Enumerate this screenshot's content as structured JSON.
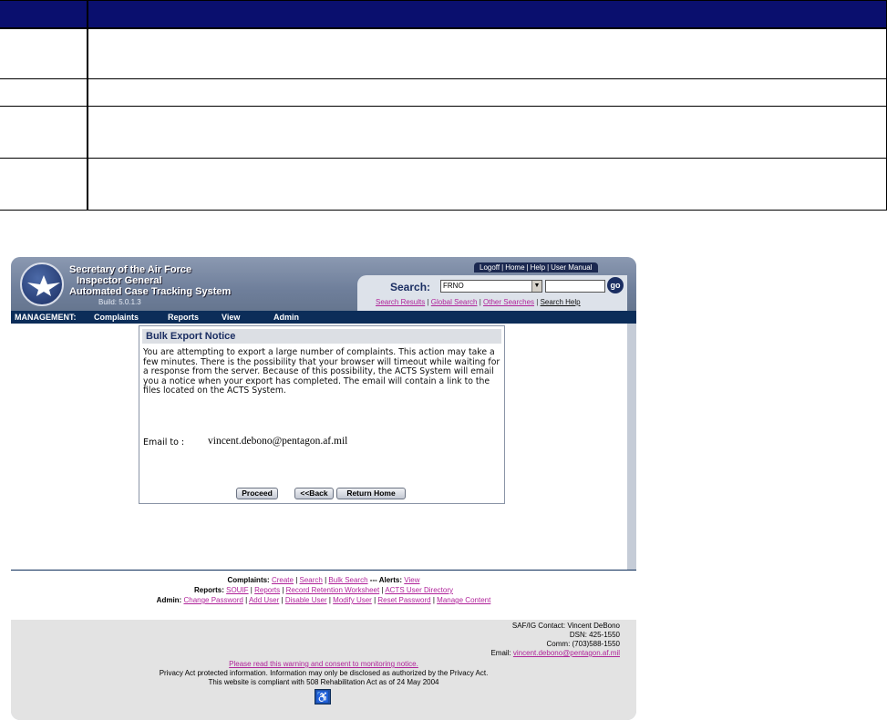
{
  "app": {
    "org_line1": "Secretary of the Air Force",
    "org_line2": "Inspector General",
    "org_line3": "Automated Case Tracking System",
    "build": "Build: 5.0.1.3"
  },
  "toplinks": [
    "Logoff",
    "Home",
    "Help",
    "User Manual"
  ],
  "search": {
    "label": "Search:",
    "selected": "FRNO",
    "go": "go",
    "links": [
      "Search Results",
      "Global Search",
      "Other Searches",
      "Search Help"
    ]
  },
  "nav": {
    "label": "MANAGEMENT:",
    "items": [
      "Complaints",
      "Reports",
      "View",
      "Admin"
    ]
  },
  "notice": {
    "title": "Bulk Export Notice",
    "message": "You are attempting to export a large number of complaints. This action may take a few minutes. There is the possibility that your browser will timeout while waiting for a response from the server. Because of this possibility, the ACTS System will email you a notice when your export has completed. The email will contain a link to the files located on the ACTS System.",
    "email_label": "Email to :",
    "email_value": "vincent.debono@pentagon.af.mil",
    "buttons": {
      "proceed": "Proceed",
      "back": "<<Back",
      "return_home": "Return Home"
    }
  },
  "footer_links": {
    "complaints_label": "Complaints:",
    "complaints": [
      "Create",
      "Search",
      "Bulk Search"
    ],
    "alerts_label": "--- Alerts:",
    "alerts": [
      "View"
    ],
    "reports_label": "Reports:",
    "reports": [
      "SOUIF",
      "Reports",
      "Record Retention Worksheet",
      "ACTS User Directory"
    ],
    "admin_label": "Admin:",
    "admin": [
      "Change Password",
      "Add User",
      "Disable User",
      "Modify User",
      "Reset Password",
      "Manage Content"
    ]
  },
  "contact": {
    "line1": "SAF/IG Contact: Vincent DeBono",
    "line2": "DSN: 425-1550",
    "line3": "Comm: (703)588-1550",
    "email_label": "Email:",
    "email": "vincent.debono@pentagon.af.mil",
    "warning_link": "Please read this warning and consent to monitoring notice.",
    "privacy": "Privacy Act protected information. Information may only be disclosed as authorized by the Privacy Act.",
    "compliance": "This website is compliant with 508 Rehabilitation Act as of 24 May 2004"
  }
}
